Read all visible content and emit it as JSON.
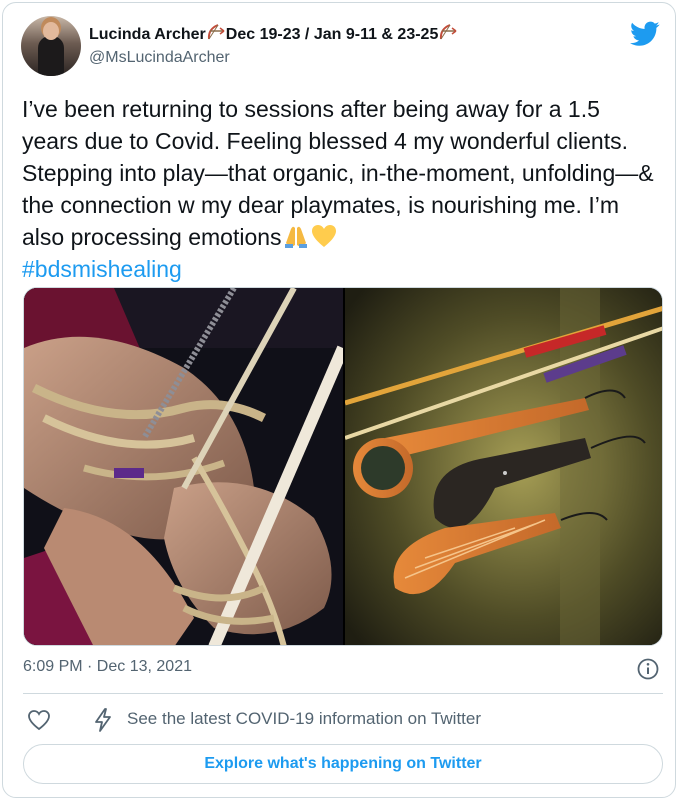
{
  "author": {
    "display_name": "Lucinda Archer",
    "display_name_suffix": "Dec 19-23 / Jan 9-11 & 23-25",
    "handle": "@MsLucindaArcher"
  },
  "tweet": {
    "text": "I’ve been returning to sessions after being away for a 1.5 years due to Covid. Feeling blessed 4 my wonderful clients. Stepping into play—that organic, in-the-moment, unfolding—& the connection w my dear playmates, is nourishing me. I’m also processing emotions",
    "hashtag": "#bdsmishealing",
    "timestamp": "6:09 PM · Dec 13, 2021"
  },
  "actions": {
    "covid_info": "See the latest COVID-19 information on Twitter",
    "explore_label": "Explore what's happening on Twitter"
  },
  "icons": {
    "avatar": "avatar",
    "bow": "bow-and-arrow-icon",
    "brand": "twitter-bird-icon",
    "praying": "folded-hands-icon",
    "heart": "yellow-heart-icon",
    "info": "info-icon",
    "like": "heart-outline-icon",
    "covid": "lightning-bolt-icon"
  },
  "colors": {
    "accent": "#1d9bf0",
    "text": "#0f1419",
    "secondary": "#536471",
    "border": "#cfd9de"
  }
}
